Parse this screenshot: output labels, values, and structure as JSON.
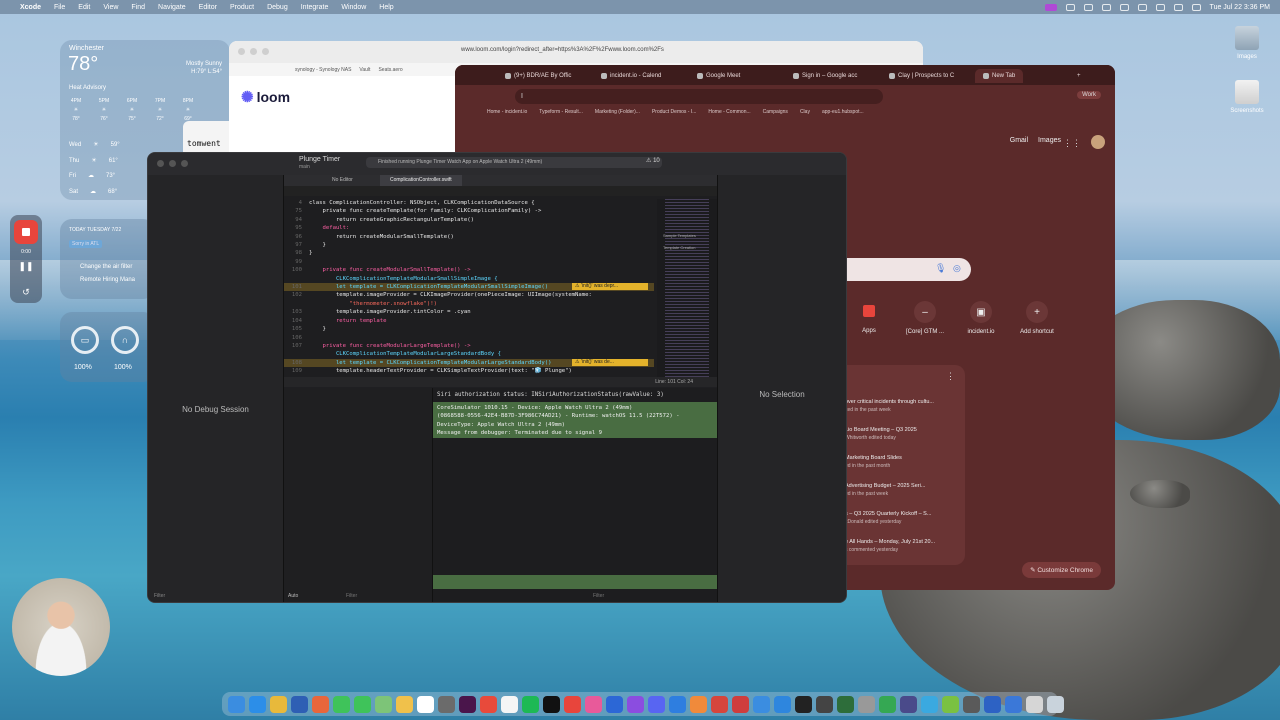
{
  "menubar": {
    "app": "Xcode",
    "items": [
      "File",
      "Edit",
      "View",
      "Find",
      "Navigate",
      "Editor",
      "Product",
      "Debug",
      "Integrate",
      "Window",
      "Help"
    ],
    "datetime": "Tue Jul 22  3:36 PM"
  },
  "weather": {
    "city": "Winchester",
    "temp": "78°",
    "condition": "Mostly Sunny",
    "hilo": "H:79° L:54°",
    "advisory": "Heat Advisory",
    "hours": [
      {
        "t": "4PM",
        "v": "78°"
      },
      {
        "t": "5PM",
        "v": "76°"
      },
      {
        "t": "6PM",
        "v": "75°"
      },
      {
        "t": "7PM",
        "v": "72°"
      },
      {
        "t": "8PM",
        "v": "69°"
      },
      {
        "t": "8:14PM",
        "v": "Sunset"
      }
    ],
    "days": [
      {
        "d": "Wed",
        "lo": "59°"
      },
      {
        "d": "Thu",
        "lo": "61°"
      },
      {
        "d": "Fri",
        "lo": "73°"
      },
      {
        "d": "Sat",
        "lo": "68°"
      }
    ]
  },
  "recorder": {
    "time": "0:00"
  },
  "todo": {
    "date": "TODAY TUESDAY 7/22",
    "badge": "Sorry in ATL",
    "items": [
      "Change the air filter",
      "Remote Hiring Mana"
    ]
  },
  "battery": {
    "left_pct": "100%",
    "right_pct": "100%"
  },
  "terminal": {
    "text": "tomwent"
  },
  "safari": {
    "url": "www.loom.com/login?redirect_after=https%3A%2F%2Fwww.loom.com%2Fs",
    "bookmarks": [
      "synology - Synology NAS",
      "Vault",
      "Seats.aero"
    ],
    "brand": "loom"
  },
  "chrome": {
    "tabs": [
      "(9+) BDR/AE By Offic",
      "incident.io - Calend",
      "Google Meet",
      "Sign in – Google acc",
      "Clay | Prospects to C",
      "New Tab"
    ],
    "active_tab": "New Tab",
    "omnibox": "I",
    "profile": "Work",
    "bookmarks": [
      "Home - incident.io",
      "Typeform - Result...",
      "Marketing (Folder)...",
      "Product Demos - I...",
      "Home - Common...",
      "Campaigns",
      "Clay",
      "app-eu1.hubspot..."
    ],
    "links": [
      "Gmail",
      "Images"
    ],
    "shortcuts": [
      {
        "label": "Apps"
      },
      {
        "label": "[Core] GTM ..."
      },
      {
        "label": "incident.io"
      },
      {
        "label": "Add shortcut"
      }
    ],
    "feed": [
      {
        "title": "over critical incidents through cultu...",
        "sub": "ited in the past week"
      },
      {
        "title": "t.io Board Meeting – Q3 2025",
        "sub": "Whitworth edited today"
      },
      {
        "title": "Marketing Board Slides",
        "sub": "ed in the past month"
      },
      {
        "title": "Advertising Budget – 2025 Seri...",
        "sub": "ed in the past week"
      },
      {
        "title": "s – Q3 2025 Quarterly Kickoff – S...",
        "sub": "cDonald edited yesterday"
      },
      {
        "title": "e All Hands – Monday, July 21st 20...",
        "sub": "s commented yesterday"
      }
    ],
    "customize": "Customize Chrome"
  },
  "xcode": {
    "scheme": "Plunge Timer",
    "scheme_sub": "main",
    "status": "Finished running Plunge Timer Watch App on Apple Watch Ultra 2 (49mm)",
    "warnings": "10",
    "no_editor": "No Editor",
    "active_file": "ComplicationController.swift",
    "left_title": "No Debug Session",
    "inspector_title": "No Selection",
    "filter": "Filter",
    "cursor": "Line: 101  Col: 24",
    "auto": "Auto",
    "minimap_labels": [
      "Sample Templates",
      "Template Creation"
    ],
    "code": [
      {
        "n": "4",
        "t": "class ComplicationController: NSObject, CLKComplicationDataSource {"
      },
      {
        "n": "75",
        "t": "    private func createTemplate(for family: CLKComplicationFamily) ->"
      },
      {
        "n": "94",
        "t": "        return createGraphicRectangularTemplate()"
      },
      {
        "n": "95",
        "t": "    default:"
      },
      {
        "n": "96",
        "t": "        return createModularSmallTemplate()"
      },
      {
        "n": "97",
        "t": "    }"
      },
      {
        "n": "98",
        "t": "}"
      },
      {
        "n": "99",
        "t": ""
      },
      {
        "n": "100",
        "t": "    private func createModularSmallTemplate() ->"
      },
      {
        "n": "",
        "t": "        CLKComplicationTemplateModularSmallSimpleImage {"
      },
      {
        "n": "101",
        "t": "        let template = CLKComplicationTemplateModularSmallSimpleImage()"
      },
      {
        "n": "102",
        "t": "        template.imageProvider = CLKImageProvider(onePieceImage: UIImage(systemName:"
      },
      {
        "n": "",
        "t": "            \"thermometer.snowflake\")!)"
      },
      {
        "n": "103",
        "t": "        template.imageProvider.tintColor = .cyan"
      },
      {
        "n": "104",
        "t": "        return template"
      },
      {
        "n": "105",
        "t": "    }"
      },
      {
        "n": "106",
        "t": ""
      },
      {
        "n": "107",
        "t": "    private func createModularLargeTemplate() ->"
      },
      {
        "n": "",
        "t": "        CLKComplicationTemplateModularLargeStandardBody {"
      },
      {
        "n": "108",
        "t": "        let template = CLKComplicationTemplateModularLargeStandardBody()"
      },
      {
        "n": "109",
        "t": "        template.headerTextProvider = CLKSimpleTextProvider(text: \"🧊 Plunge\")"
      }
    ],
    "warn1": "'init()' was depr...",
    "warn2": "'init()' was de...",
    "console_line": "Siri authorization status: INSiriAuthorizationStatus(rawValue: 3)",
    "console_block": [
      "CoreSimulator 1010.15 - Device: Apple Watch Ultra 2 (49mm)",
      "(0868588-0556-42E4-B87D-3F986C74AD21) - Runtime: watchOS 11.5 (22T572) -",
      "DeviceType: Apple Watch Ultra 2 (49mm)",
      "Message from debugger: Terminated due to signal 9"
    ]
  },
  "desktop": {
    "icons": [
      "Images",
      "Screenshots"
    ]
  }
}
